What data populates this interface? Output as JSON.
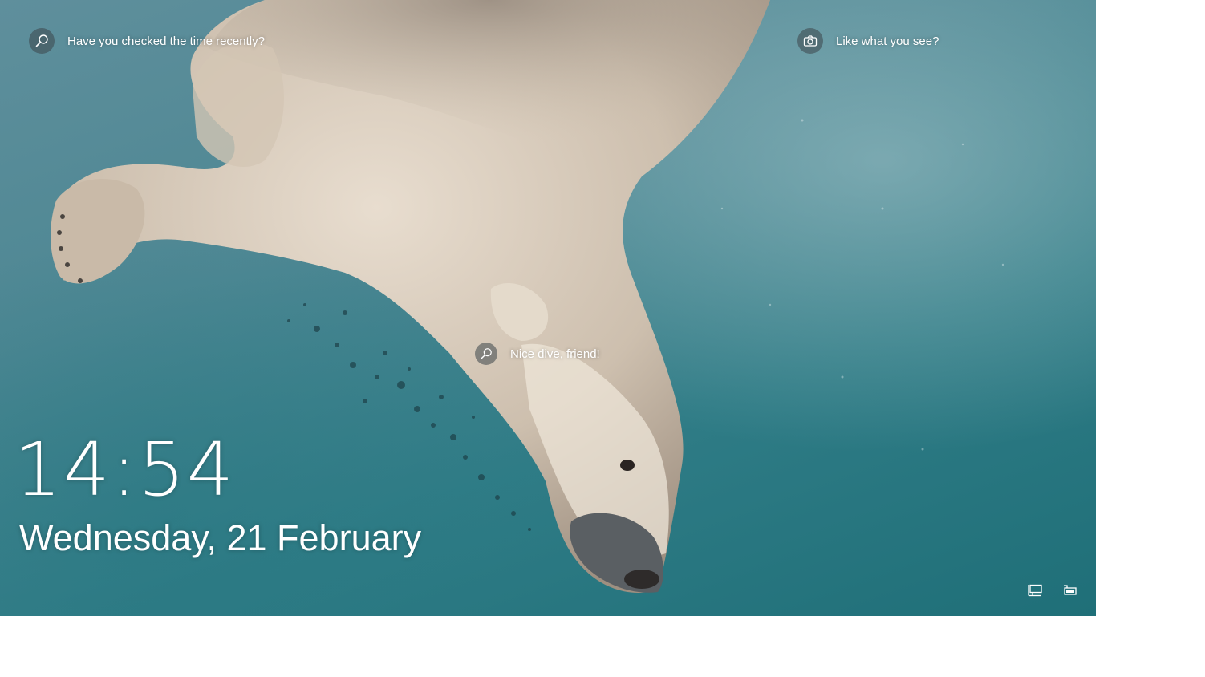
{
  "spotlight": {
    "top_left": {
      "text": "Have you checked the time recently?",
      "icon": "search-icon"
    },
    "top_right": {
      "text": "Like what you see?",
      "icon": "camera-icon"
    },
    "center": {
      "text": "Nice dive, friend!",
      "icon": "search-icon"
    }
  },
  "clock": {
    "time": "14:54",
    "date": "Wednesday, 21 February"
  },
  "status_icons": [
    "network-icon",
    "battery-icon"
  ],
  "colors": {
    "text": "#ffffff",
    "water_dark": "#1f6f78",
    "water_light": "#5f8f9c",
    "bear_fur": "#d9cfc1"
  }
}
